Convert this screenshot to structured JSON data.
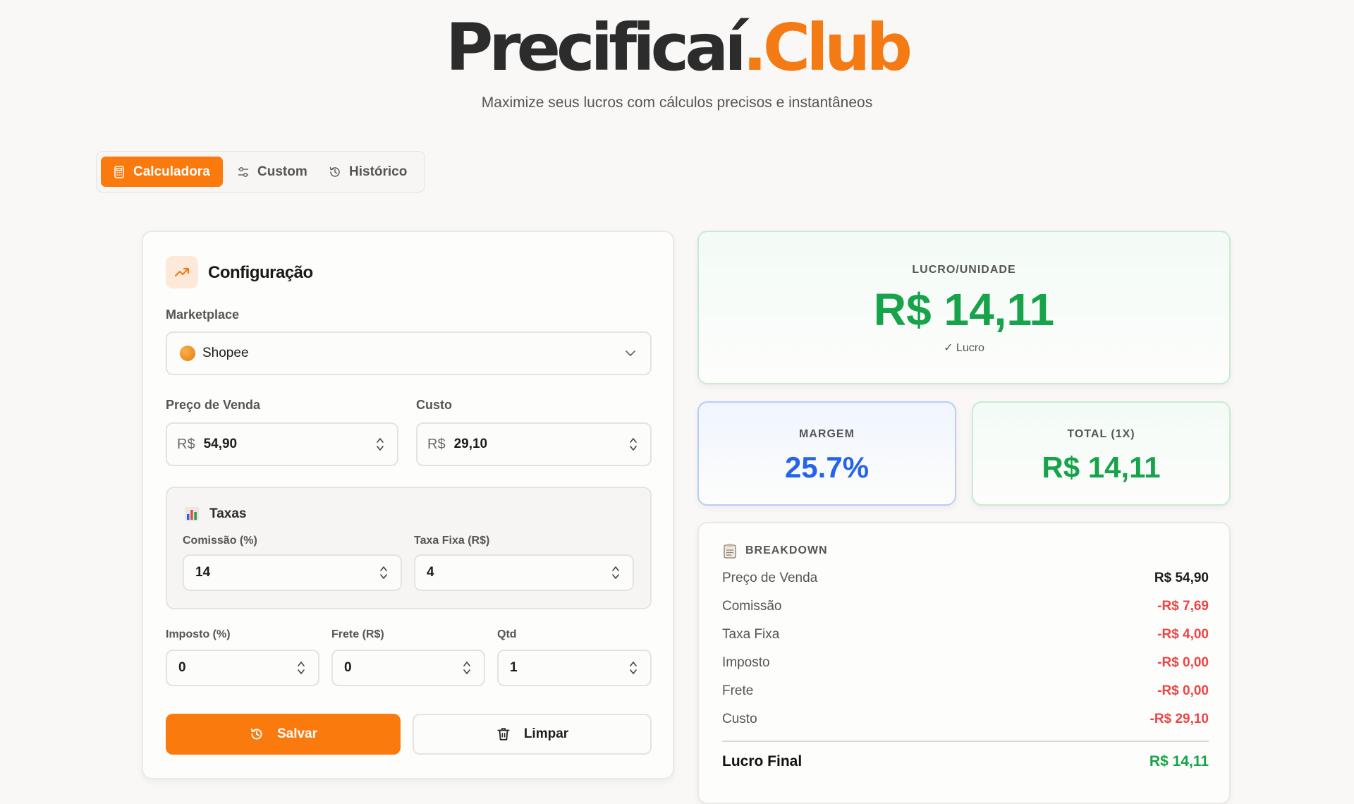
{
  "brand": {
    "part1": "Precificaí",
    "part2": ".Club",
    "tagline": "Maximize seus lucros com cálculos precisos e instantâneos"
  },
  "tabs": [
    {
      "label": "Calculadora",
      "icon": "calculator-icon",
      "active": true
    },
    {
      "label": "Custom",
      "icon": "sliders-icon",
      "active": false
    },
    {
      "label": "Histórico",
      "icon": "history-icon",
      "active": false
    }
  ],
  "config": {
    "title": "Configuração",
    "marketplace_label": "Marketplace",
    "marketplace_value": "Shopee",
    "price_label": "Preço de Venda",
    "price_prefix": "R$",
    "price_value": "54,90",
    "cost_label": "Custo",
    "cost_prefix": "R$",
    "cost_value": "29,10",
    "taxes": {
      "title": "Taxas",
      "commission_label": "Comissão (%)",
      "commission_value": "14",
      "fixed_fee_label": "Taxa Fixa (R$)",
      "fixed_fee_value": "4"
    },
    "tax_label": "Imposto (%)",
    "tax_value": "0",
    "freight_label": "Frete (R$)",
    "freight_value": "0",
    "qty_label": "Qtd",
    "qty_value": "1",
    "save_label": "Salvar",
    "clear_label": "Limpar"
  },
  "results": {
    "profit_caption": "LUCRO/UNIDADE",
    "profit_value": "R$ 14,11",
    "profit_status": "✓ Lucro",
    "margin_caption": "MARGEM",
    "margin_value": "25.7%",
    "total_caption": "TOTAL (1X)",
    "total_value": "R$ 14,11"
  },
  "breakdown": {
    "title": "BREAKDOWN",
    "rows": [
      {
        "label": "Preço de Venda",
        "value": "R$ 54,90"
      },
      {
        "label": "Comissão",
        "value": "-R$ 7,69"
      },
      {
        "label": "Taxa Fixa",
        "value": "-R$ 4,00"
      },
      {
        "label": "Imposto",
        "value": "-R$ 0,00"
      },
      {
        "label": "Frete",
        "value": "-R$ 0,00"
      },
      {
        "label": "Custo",
        "value": "-R$ 29,10"
      }
    ],
    "final_label": "Lucro Final",
    "final_value": "R$ 14,11"
  },
  "colors": {
    "accent": "#fb7a0e",
    "profit": "#16a34a",
    "margin": "#2563eb",
    "negative": "#ef4444"
  }
}
